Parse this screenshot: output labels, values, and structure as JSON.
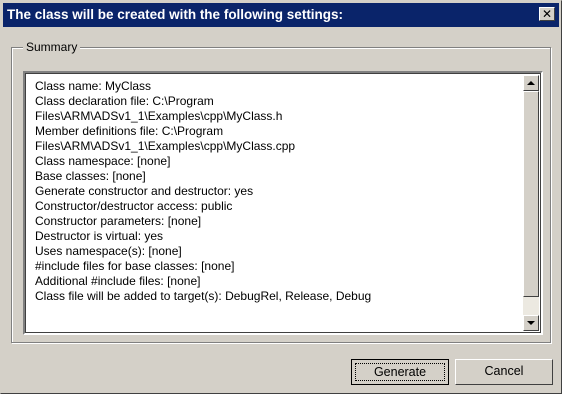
{
  "dialog": {
    "title": "The class will be created with the following settings:",
    "close_glyph": "✕"
  },
  "summary": {
    "label": "Summary",
    "lines": [
      "Class name: MyClass",
      "Class declaration file: C:\\Program",
      "Files\\ARM\\ADSv1_1\\Examples\\cpp\\MyClass.h",
      "Member definitions file: C:\\Program",
      "Files\\ARM\\ADSv1_1\\Examples\\cpp\\MyClass.cpp",
      "Class namespace: [none]",
      "Base classes: [none]",
      "Generate constructor and destructor: yes",
      "Constructor/destructor access: public",
      "Constructor parameters: [none]",
      "Destructor is virtual: yes",
      "Uses namespace(s): [none]",
      "#include files for base classes: [none]",
      "Additional #include files: [none]",
      "Class file will be added to target(s): DebugRel, Release, Debug"
    ]
  },
  "buttons": {
    "generate": "Generate",
    "cancel": "Cancel"
  }
}
